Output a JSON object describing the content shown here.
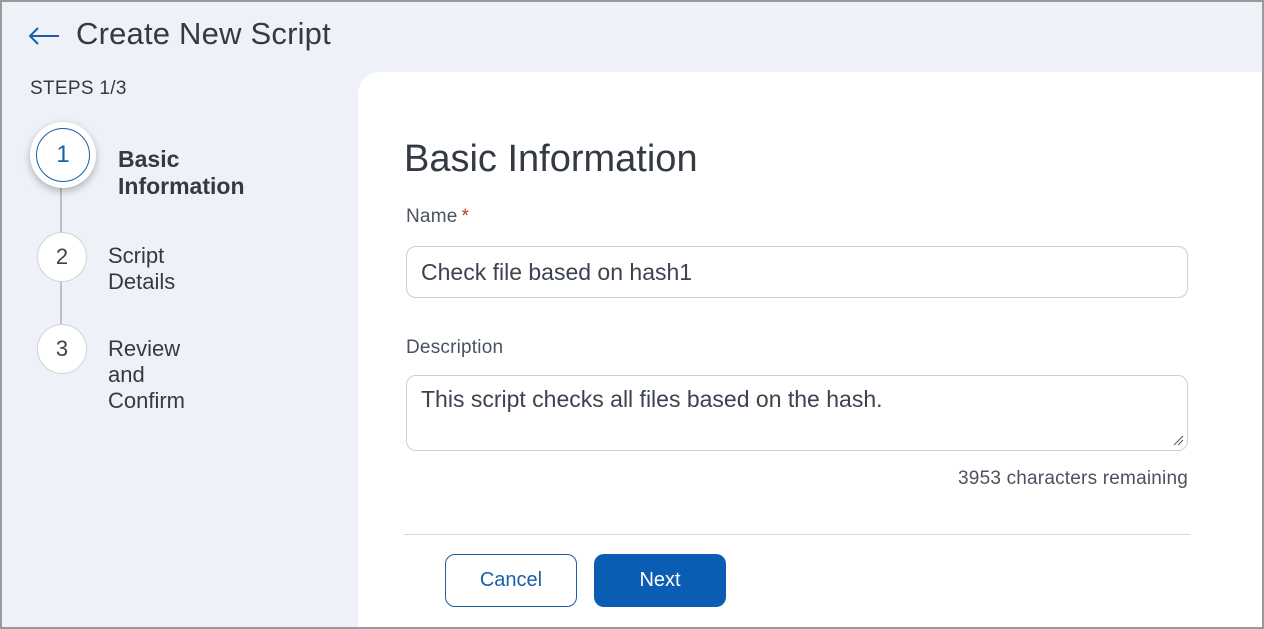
{
  "header": {
    "title": "Create New Script",
    "back_icon": "arrow-left-icon"
  },
  "steps": {
    "label": "STEPS 1/3",
    "items": [
      {
        "number": "1",
        "label": "Basic Information",
        "active": true
      },
      {
        "number": "2",
        "label": "Script Details",
        "active": false
      },
      {
        "number": "3",
        "label": "Review and Confirm",
        "active": false
      }
    ]
  },
  "form": {
    "section_title": "Basic Information",
    "name_label": "Name",
    "name_required_marker": "*",
    "name_value": "Check file based on hash1",
    "description_label": "Description",
    "description_value": "This script checks all files based on the hash.",
    "characters_remaining": "3953 characters remaining"
  },
  "actions": {
    "cancel_label": "Cancel",
    "next_label": "Next"
  },
  "colors": {
    "accent": "#0b5cb3",
    "background": "#eef2f8",
    "required": "#c0392b"
  }
}
